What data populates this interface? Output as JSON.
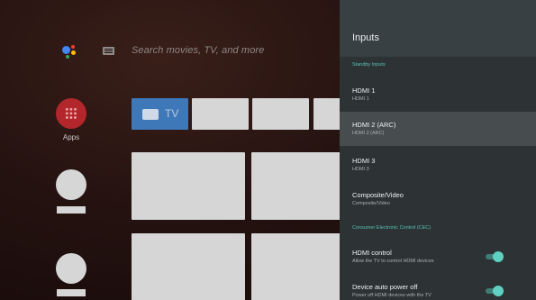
{
  "home": {
    "search_placeholder": "Search movies, TV, and more",
    "apps_label": "Apps",
    "tv_tile_label": "TV"
  },
  "panel": {
    "title": "Inputs",
    "sections": {
      "standby": "Standby Inputs",
      "cec": "Consumer Electronic Control (CEC)"
    },
    "inputs": [
      {
        "title": "HDMI 1",
        "subtitle": "HDMI 1",
        "selected": false
      },
      {
        "title": "HDMI 2 (ARC)",
        "subtitle": "HDMI 2 (ARC)",
        "selected": true
      },
      {
        "title": "HDMI 3",
        "subtitle": "HDMI 3",
        "selected": false
      },
      {
        "title": "Composite/Video",
        "subtitle": "Composite/Video",
        "selected": false
      }
    ],
    "cec_settings": [
      {
        "title": "HDMI control",
        "subtitle": "Allow the TV to control HDMI devices",
        "enabled": true
      },
      {
        "title": "Device auto power off",
        "subtitle": "Power off HDMI devices with the TV",
        "enabled": true
      }
    ]
  },
  "colors": {
    "accent": "#5fd0c1",
    "apps_red": "#b3262b",
    "tv_blue": "#3f78b8"
  }
}
